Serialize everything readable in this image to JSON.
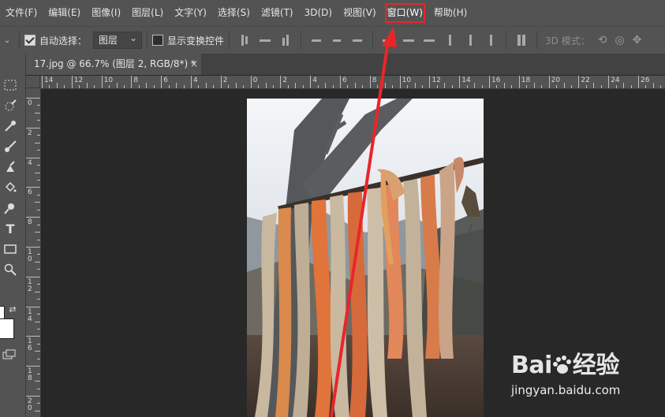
{
  "menubar": {
    "items": [
      "文件(F)",
      "编辑(E)",
      "图像(I)",
      "图层(L)",
      "文字(Y)",
      "选择(S)",
      "滤镜(T)",
      "3D(D)",
      "视图(V)",
      "窗口(W)",
      "帮助(H)"
    ]
  },
  "options": {
    "auto_select_label": "自动选择：",
    "auto_select_checked": true,
    "layer_select_value": "图层",
    "show_transform_label": "显示变换控件",
    "show_transform_checked": false,
    "mode_label": "3D 模式："
  },
  "document": {
    "tab_title": "17.jpg @ 66.7% (图层 2, RGB/8*) *",
    "close_glyph": "×"
  },
  "ruler": {
    "h_labels": [
      "14",
      "12",
      "10",
      "8",
      "6",
      "4",
      "2",
      "0",
      "2",
      "4",
      "6",
      "8",
      "10",
      "12",
      "14",
      "16",
      "18",
      "20",
      "22",
      "24",
      "26"
    ],
    "v_labels": [
      "0",
      "2",
      "4",
      "6",
      "8",
      "10",
      "12",
      "14",
      "16",
      "18",
      "20"
    ]
  },
  "watermark": {
    "brand": "Bai",
    "brand_suffix": "经验",
    "url": "jingyan.baidu.com"
  },
  "colors": {
    "highlight": "#e8262a",
    "panel": "#535353",
    "canvas": "#282828"
  }
}
